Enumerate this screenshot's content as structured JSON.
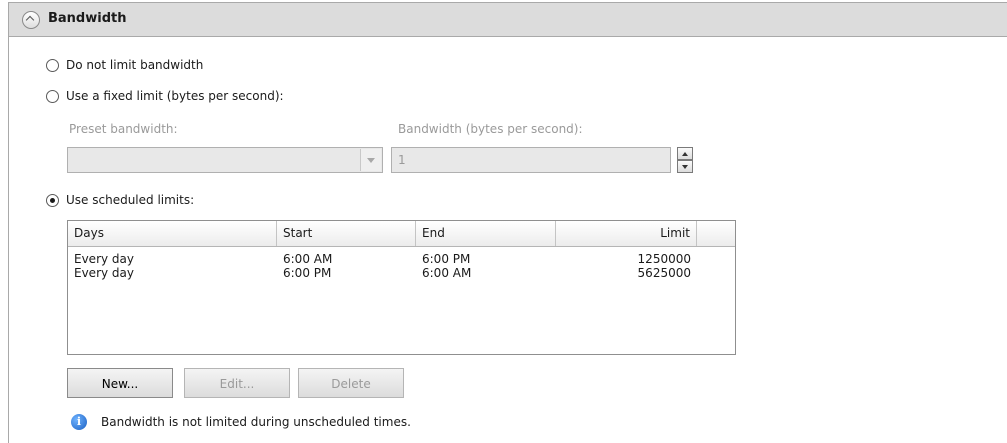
{
  "header": {
    "title": "Bandwidth"
  },
  "options": {
    "no_limit": "Do not limit bandwidth",
    "fixed_limit": "Use a fixed limit (bytes per second):",
    "scheduled": "Use scheduled limits:",
    "selected": "scheduled"
  },
  "fixed": {
    "preset_label": "Preset bandwidth:",
    "preset_value": "",
    "bandwidth_label": "Bandwidth (bytes per second):",
    "bandwidth_value": "1"
  },
  "table": {
    "columns": [
      "Days",
      "Start",
      "End",
      "Limit"
    ],
    "rows": [
      {
        "days": "Every day",
        "start": "6:00 AM",
        "end": "6:00 PM",
        "limit": "1250000"
      },
      {
        "days": "Every day",
        "start": "6:00 PM",
        "end": "6:00 AM",
        "limit": "5625000"
      }
    ]
  },
  "buttons": {
    "new": "New...",
    "edit": "Edit...",
    "delete": "Delete"
  },
  "info": {
    "icon": "info-icon",
    "text": "Bandwidth is not limited during unscheduled times."
  }
}
